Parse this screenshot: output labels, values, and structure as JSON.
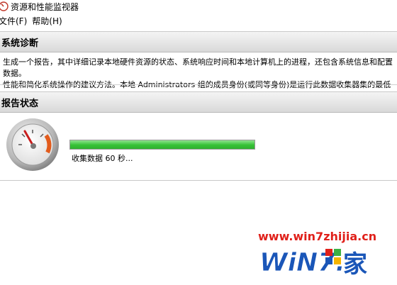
{
  "window": {
    "title": "资源和性能监视器",
    "icon": "resource-monitor-icon"
  },
  "menu": {
    "items": [
      {
        "label": "文件(F)"
      },
      {
        "label": "帮助(H)"
      }
    ]
  },
  "diagnostics": {
    "header": "系统诊断",
    "description_line1": "生成一个报告，其中详细记录本地硬件资源的状态、系统响应时间和本地计算机上的进程，还包含系统信息和配置数据。",
    "description_line2": "性能和简化系统操作的建议方法。本地 Administrators 组的成员身份(或同等身份)是运行此数据收集器集的最低要求。"
  },
  "report_status": {
    "header": "报告状态",
    "gauge_icon": "gauge-icon",
    "progress_fraction": 1.0,
    "progress_text": "收集数据 60 秒..."
  },
  "watermark": {
    "url": "www.win7zhijia.cn",
    "logo_text": "WiN7.家"
  },
  "colors": {
    "progress_green": "#35c235",
    "watermark_red": "#e0201a",
    "watermark_blue": "#1a56b8"
  }
}
